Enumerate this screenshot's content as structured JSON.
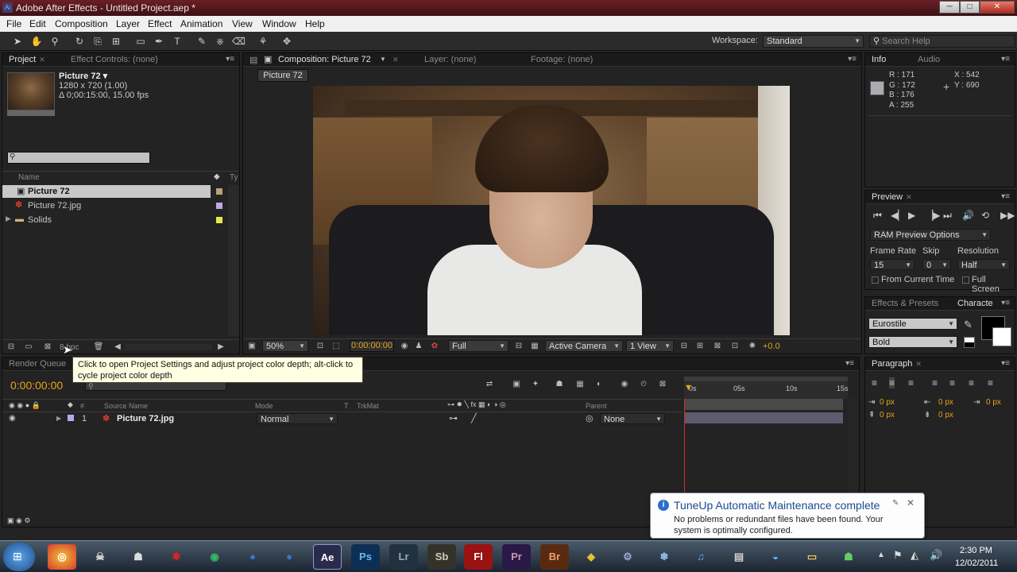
{
  "window": {
    "title": "Adobe After Effects - Untitled Project.aep *",
    "app_icon": "Ai",
    "minimize": "─",
    "maximize": "□",
    "close": "✕"
  },
  "menu": [
    "File",
    "Edit",
    "Composition",
    "Layer",
    "Effect",
    "Animation",
    "View",
    "Window",
    "Help"
  ],
  "toolbar": {
    "workspace_label": "Workspace:",
    "workspace_value": "Standard",
    "search_placeholder": "Search Help"
  },
  "project_panel": {
    "tab_project": "Project",
    "tab_effect_controls": "Effect Controls: (none)",
    "item_title": "Picture 72 ▾",
    "item_dims": "1280 x 720 (1.00)",
    "item_duration": "Δ 0;00:15:00, 15.00 fps",
    "col_name": "Name",
    "col_type": "Ty",
    "items": [
      {
        "name": "Picture 72",
        "color": "#b8a47a",
        "icon": "composition-icon"
      },
      {
        "name": "Picture 72.jpg",
        "color": "#b9a9e8",
        "icon": "image-file-icon"
      },
      {
        "name": "Solids",
        "color": "#e8e84a",
        "icon": "folder-icon"
      }
    ],
    "bpc": "8 bpc"
  },
  "composition_panel": {
    "tab_composition": "Composition: Picture 72",
    "tab_layer": "Layer: (none)",
    "tab_footage": "Footage: (none)",
    "comp_name_tab": "Picture 72",
    "zoom": "50%",
    "timecode": "0:00:00:00",
    "resolution": "Full",
    "camera": "Active Camera",
    "views": "1 View",
    "exposure": "+0.0"
  },
  "info_panel": {
    "tab_info": "Info",
    "tab_audio": "Audio",
    "r": "R : 171",
    "g": "G : 172",
    "b": "B : 176",
    "a": "A : 255",
    "x": "X : 542",
    "y": "Y : 690"
  },
  "preview_panel": {
    "tab": "Preview",
    "ram_preview": "RAM Preview Options",
    "frame_rate_label": "Frame Rate",
    "skip_label": "Skip",
    "resolution_label": "Resolution",
    "frame_rate": "15",
    "skip": "0",
    "resolution": "Half",
    "from_current": "From Current Time",
    "full_screen": "Full Screen"
  },
  "effects_panel": {
    "tab_effects": "Effects & Presets",
    "tab_character": "Characte",
    "font": "Eurostile",
    "style": "Bold"
  },
  "paragraph_panel": {
    "tab": "Paragraph",
    "indent_values": [
      "0 px",
      "0 px",
      "0 px",
      "0 px",
      "0 px"
    ]
  },
  "timeline": {
    "tab_render_queue": "Render Queue",
    "timecode": "0:00:00:00",
    "col_source": "Source Name",
    "col_mode": "Mode",
    "col_t": "T",
    "col_trkmat": "TrkMat",
    "col_parent": "Parent",
    "ruler": [
      "0s",
      "05s",
      "10s",
      "15s"
    ],
    "layer": {
      "number": "1",
      "name": "Picture 72.jpg",
      "mode": "Normal",
      "parent": "None"
    }
  },
  "tooltip": "Click to open Project Settings and adjust project color depth; alt-click to cycle project color depth",
  "notification": {
    "title": "TuneUp Automatic Maintenance complete",
    "body": "No problems or redundant files have been found. Your system is optimally configured."
  },
  "taskbar": {
    "apps": [
      "Ae",
      "Ps",
      "Lr",
      "Sb",
      "Fl",
      "Pr",
      "Br"
    ],
    "time": "2:30 PM",
    "date": "12/02/2011"
  },
  "colors": {
    "accent_orange": "#e8a317",
    "title_red": "#6b1f25"
  }
}
